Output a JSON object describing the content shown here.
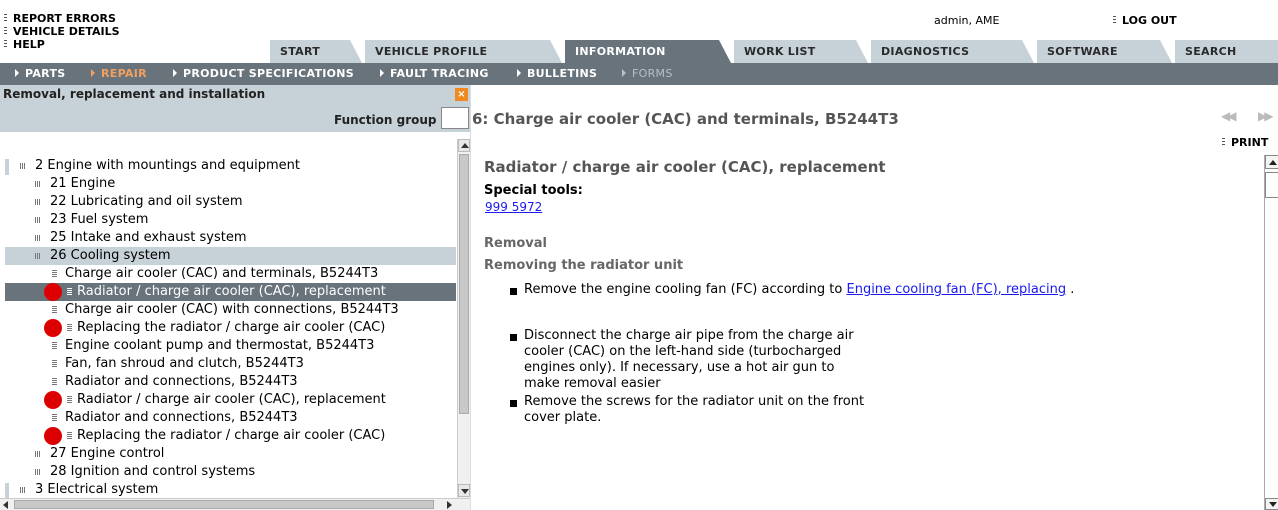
{
  "top_links": {
    "report_errors": "REPORT ERRORS",
    "vehicle_details": "VEHICLE DETAILS",
    "help": "HELP"
  },
  "user": {
    "name": "admin, AME",
    "logout": "LOG OUT"
  },
  "tabs": [
    {
      "label": "START"
    },
    {
      "label": "VEHICLE PROFILE"
    },
    {
      "label": "INFORMATION"
    },
    {
      "label": "WORK LIST"
    },
    {
      "label": "DIAGNOSTICS"
    },
    {
      "label": "SOFTWARE"
    },
    {
      "label": "SEARCH"
    }
  ],
  "subnav": [
    {
      "label": "PARTS"
    },
    {
      "label": "REPAIR"
    },
    {
      "label": "PRODUCT SPECIFICATIONS"
    },
    {
      "label": "FAULT TRACING"
    },
    {
      "label": "BULLETINS"
    },
    {
      "label": "FORMS"
    }
  ],
  "left_panel": {
    "title": "Removal, replacement and installation",
    "close": "×",
    "function_group_label": "Function group",
    "function_group_value": ""
  },
  "tree": [
    {
      "label": "2 Engine with mountings and equipment"
    },
    {
      "label": "21 Engine"
    },
    {
      "label": "22 Lubricating and oil system"
    },
    {
      "label": "23 Fuel system"
    },
    {
      "label": "25 Intake and exhaust system"
    },
    {
      "label": "26 Cooling system"
    },
    {
      "label": "Charge air cooler (CAC) and terminals, B5244T3"
    },
    {
      "label": "Radiator / charge air cooler (CAC), replacement"
    },
    {
      "label": "Charge air cooler (CAC) with connections, B5244T3"
    },
    {
      "label": "Replacing the radiator / charge air cooler (CAC)"
    },
    {
      "label": "Engine coolant pump and thermostat, B5244T3"
    },
    {
      "label": "Fan, fan shroud and clutch, B5244T3"
    },
    {
      "label": "Radiator and connections, B5244T3"
    },
    {
      "label": "Radiator / charge air cooler (CAC), replacement"
    },
    {
      "label": "Radiator and connections, B5244T3"
    },
    {
      "label": "Replacing the radiator / charge air cooler (CAC)"
    },
    {
      "label": "27 Engine control"
    },
    {
      "label": "28 Ignition and control systems"
    },
    {
      "label": "3 Electrical system"
    }
  ],
  "document": {
    "title": "6: Charge air cooler (CAC) and terminals, B5244T3",
    "print": "PRINT",
    "subtitle": "Radiator / charge air cooler (CAC), replacement",
    "special_tools_label": "Special tools:",
    "special_tools_link": "999 5972",
    "removal": "Removal",
    "removing": "Removing the radiator unit",
    "steps": {
      "step1_pre": "Remove the engine cooling fan (FC) according to ",
      "step1_link": "Engine cooling fan (FC), replacing",
      "step1_post": " .",
      "step2_l1": "Disconnect the charge air pipe from the charge air",
      "step2_l2": "cooler (CAC) on the left-hand side (turbocharged",
      "step2_l3": "engines only). If necessary, use a hot air gun to",
      "step2_l4": "make removal easier",
      "step3_l1": "Remove the screws for the radiator unit on the front",
      "step3_l2": "cover plate."
    }
  },
  "colors": {
    "tab_bg": "#c7d2d8",
    "active_bg": "#68737c",
    "accent_orange": "#f08a20",
    "marker_red": "#dd0000",
    "link": "#1a1aee"
  }
}
